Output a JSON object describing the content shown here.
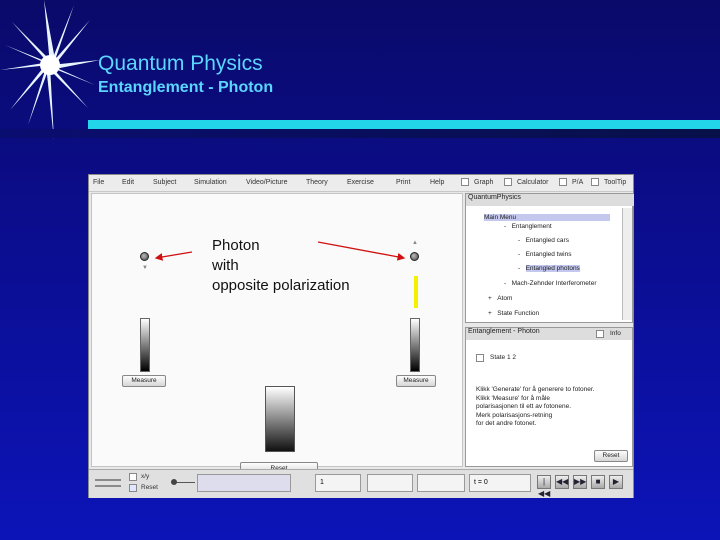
{
  "slide": {
    "title": "Quantum Physics",
    "subtitle": "Entanglement   -   Photon"
  },
  "app": {
    "menu": [
      "File",
      "Edit",
      "Subject",
      "Simulation",
      "Video/Picture",
      "Theory",
      "Exercise",
      "Print",
      "Help"
    ],
    "toggles": [
      "Graph",
      "Calculator",
      "P/A",
      "ToolTip"
    ],
    "annotation": [
      "Photon",
      "with",
      "opposite polarization"
    ],
    "measure_left": "Measure",
    "measure_right": "Measure",
    "reset_label": "Reset",
    "tree": {
      "title": "QuantumPhysics",
      "main_menu": "Main Menu",
      "items": [
        {
          "prefix": "-",
          "label": "Entanglement"
        },
        {
          "prefix": "-",
          "label": "Entangled cars"
        },
        {
          "prefix": "-",
          "label": "Entangled twins"
        },
        {
          "prefix": "-",
          "label": "Entangled photons"
        },
        {
          "prefix": "-",
          "label": "Mach-Zehnder Interferometer"
        },
        {
          "prefix": "+",
          "label": "Atom"
        },
        {
          "prefix": "+",
          "label": "State Function"
        }
      ]
    },
    "info": {
      "header": "Entanglement - Photon",
      "info_label": "Info",
      "state_label": "State 1  2",
      "text": "Klikk 'Generate' for å generere to fotoner.\nKlikk 'Measure' for å måle\npolarisasjonen til ett av fotonene.\nMerk polarisasjons-retning\nfor det andre fotonet.",
      "reset_label": "Reset"
    },
    "statusbar": {
      "xy_label": "x/y",
      "reset_label": "Reset",
      "spinner_value": "1",
      "time": "t = 0",
      "play_buttons": [
        "|◀◀",
        "◀◀",
        "▶▶",
        "■",
        "▶"
      ]
    }
  }
}
